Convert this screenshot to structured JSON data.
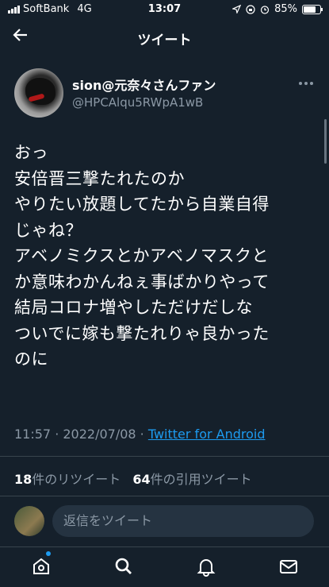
{
  "status_bar": {
    "carrier": "SoftBank",
    "network": "4G",
    "time": "13:07",
    "battery": "85%",
    "battery_level": 0.85
  },
  "nav": {
    "back_icon": "arrow-left-icon",
    "title": "ツイート"
  },
  "tweet": {
    "author_name": "sion@元奈々さんファン",
    "author_handle": "@HPCAlqu5RWpA1wB",
    "more_icon": "more-horizontal-icon",
    "text_lines": [
      "おっ",
      "安倍晋三撃たれたのか",
      "やりたい放題してたから自業自得",
      "じゃね？",
      "アベノミクスとかアベノマスクと",
      "か意味わかんねぇ事ばかりやって",
      "結局コロナ増やしただけだしな",
      "ついでに嫁も撃たれりゃ良かった",
      "のに"
    ],
    "timestamp": "11:57 · 2022/07/08 · ",
    "source": "Twitter for Android",
    "retweet_count": "18",
    "retweet_label": "件のリツイート",
    "quote_count": "64",
    "quote_label": "件の引用ツイート"
  },
  "reply": {
    "placeholder": "返信をツイート"
  },
  "tabs": [
    {
      "name": "home-icon"
    },
    {
      "name": "search-icon"
    },
    {
      "name": "notifications-icon"
    },
    {
      "name": "messages-icon"
    }
  ],
  "colors": {
    "background": "#15202b",
    "accent": "#1d9bf0",
    "secondary_text": "#8b98a5"
  }
}
